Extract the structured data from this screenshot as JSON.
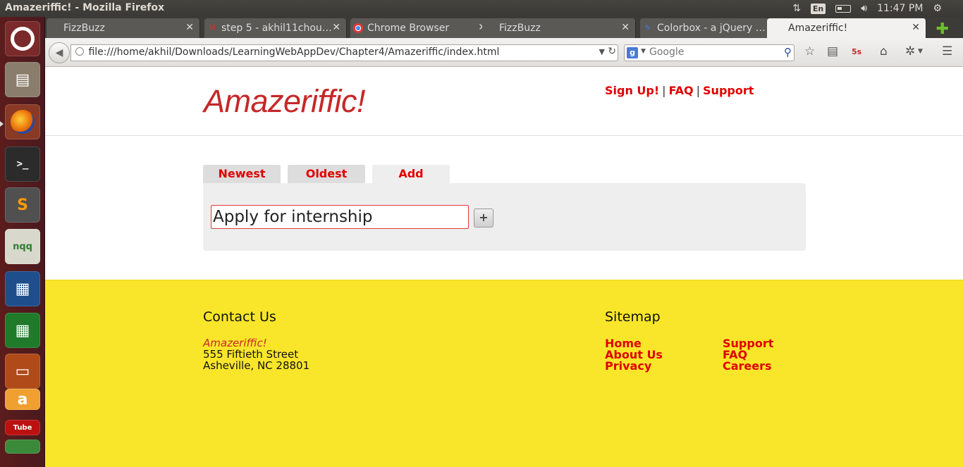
{
  "system": {
    "window_title": "Amazeriffic! - Mozilla Firefox",
    "keyboard_layout": "En",
    "clock": "11:47 PM"
  },
  "launcher": {
    "items": [
      "ubuntu-dash",
      "files",
      "firefox",
      "terminal",
      "sublime-text",
      "notepadqq",
      "libreoffice-writer",
      "libreoffice-calc",
      "libreoffice-impress",
      "amazon",
      "youtube",
      "more"
    ],
    "notepad_label": "nqq",
    "youtube_label": "Tube"
  },
  "browser": {
    "tabs": [
      {
        "label": "FizzBuzz",
        "favicon": "",
        "active": false
      },
      {
        "label": "step 5 - akhil11chou…",
        "favicon": "gmail-icon",
        "active": false
      },
      {
        "label": "Chrome Browser",
        "favicon": "chrome-icon",
        "active": false
      },
      {
        "label": "FizzBuzz",
        "favicon": "",
        "active": false
      },
      {
        "label": "Colorbox - a jQuery …",
        "favicon": "colorbox-icon",
        "active": false
      },
      {
        "label": "Amazeriffic!",
        "favicon": "",
        "active": true
      }
    ],
    "url": "file:///home/akhil/Downloads/LearningWebAppDev/Chapter4/Amazeriffic/index.html",
    "search_placeholder": "Google",
    "search_engine_letter": "g"
  },
  "page": {
    "logo": "Amazeriffic!",
    "header_links": [
      "Sign Up!",
      "FAQ",
      "Support"
    ],
    "tabs": [
      {
        "label": "Newest",
        "active": false
      },
      {
        "label": "Oldest",
        "active": false
      },
      {
        "label": "Add",
        "active": true
      }
    ],
    "add_input_value": "Apply for internship",
    "add_button_label": "+",
    "footer": {
      "contact_heading": "Contact Us",
      "company": "Amazeriffic!",
      "street": "555 Fiftieth Street",
      "city": "Asheville, NC 28801",
      "sitemap_heading": "Sitemap",
      "sitemap_col1": [
        "Home",
        "About Us",
        "Privacy"
      ],
      "sitemap_col2": [
        "Support",
        "FAQ",
        "Careers"
      ]
    }
  },
  "colors": {
    "accent_red": "#e00000",
    "logo_red": "#c62828",
    "footer_yellow": "#f9e62b",
    "launcher_bg": "#5b1c1c"
  }
}
